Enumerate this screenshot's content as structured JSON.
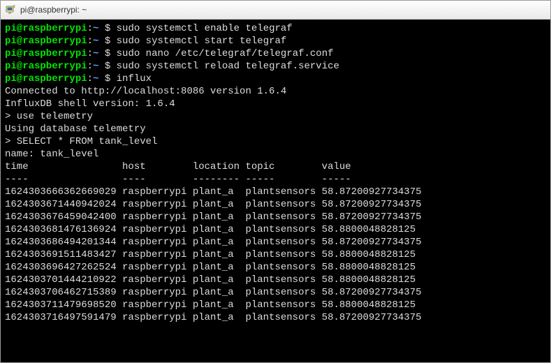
{
  "window": {
    "title": "pi@raspberrypi: ~"
  },
  "prompt": {
    "userhost": "pi@raspberrypi",
    "colon": ":",
    "cwd": "~",
    "dollar": " $ "
  },
  "commands": [
    "sudo systemctl enable telegraf",
    "sudo systemctl start telegraf",
    "sudo nano /etc/telegraf/telegraf.conf",
    "sudo systemctl reload telegraf.service",
    "influx"
  ],
  "influxOutput": {
    "connected": "Connected to http://localhost:8086 version 1.6.4",
    "shell": "InfluxDB shell version: 1.6.4",
    "useCmd": "> use telemetry",
    "useResp": "Using database telemetry",
    "selectCmd": "> SELECT * FROM tank_level",
    "nameLine": "name: tank_level",
    "headerLine": "time                host        location topic        value",
    "dashesLine": "----                ----        -------- -----        -----",
    "rows": [
      "1624303666362669029 raspberrypi plant_a  plantsensors 58.87200927734375",
      "1624303671440942024 raspberrypi plant_a  plantsensors 58.87200927734375",
      "1624303676459042400 raspberrypi plant_a  plantsensors 58.87200927734375",
      "1624303681476136924 raspberrypi plant_a  plantsensors 58.8800048828125",
      "1624303686494201344 raspberrypi plant_a  plantsensors 58.87200927734375",
      "1624303691511483427 raspberrypi plant_a  plantsensors 58.8800048828125",
      "1624303696427262524 raspberrypi plant_a  plantsensors 58.8800048828125",
      "1624303701444210922 raspberrypi plant_a  plantsensors 58.8800048828125",
      "1624303706462715389 raspberrypi plant_a  plantsensors 58.87200927734375",
      "1624303711479698520 raspberrypi plant_a  plantsensors 58.8800048828125",
      "1624303716497591479 raspberrypi plant_a  plantsensors 58.87200927734375"
    ]
  }
}
